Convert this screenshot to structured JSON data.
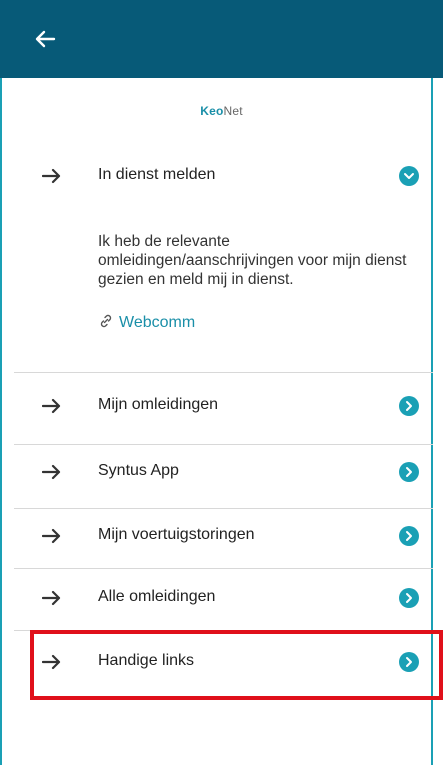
{
  "header": {
    "back_icon": "arrow-left-icon"
  },
  "brand": {
    "part1": "Keo",
    "part2": "Net"
  },
  "menu": [
    {
      "label": "In dienst melden",
      "expanded": true
    },
    {
      "label": "Mijn omleidingen",
      "expanded": false
    },
    {
      "label": "Syntus App",
      "expanded": false
    },
    {
      "label": "Mijn voertuigstoringen",
      "expanded": false
    },
    {
      "label": "Alle omleidingen",
      "expanded": false
    },
    {
      "label": "Handige links",
      "expanded": false
    }
  ],
  "expanded_panel": {
    "text": "Ik heb de relevante omleidingen/aanschrijvingen voor mijn dienst gezien en meld mij in dienst.",
    "link_label": "Webcomm",
    "link_icon": "link-icon"
  },
  "colors": {
    "header_bg": "#075a78",
    "accent": "#1aa0b5",
    "highlight": "#e0101a"
  }
}
